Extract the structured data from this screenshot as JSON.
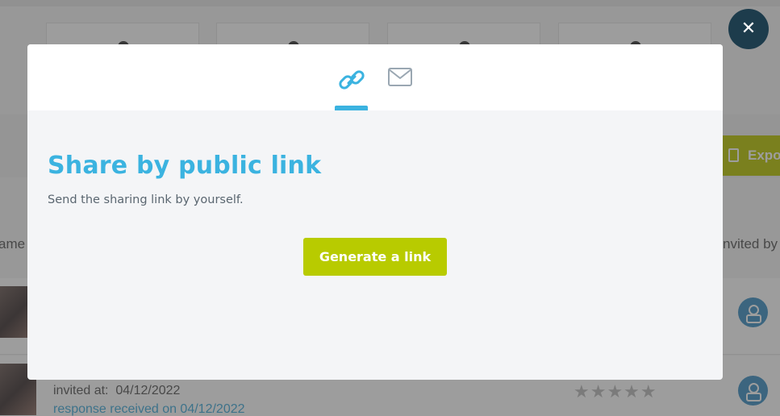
{
  "background": {
    "export_label": "Expo",
    "column_left_label": "ame",
    "column_right_label": "nvited by",
    "invited_label": "invited at:",
    "invited_date": "04/12/2022",
    "response_text": "response received on 04/12/2022",
    "stars": "★★★★★"
  },
  "close": {
    "glyph": "✕"
  },
  "modal": {
    "tabs": [
      {
        "name": "link",
        "icon": "link-icon",
        "active": true
      },
      {
        "name": "email",
        "icon": "envelope-icon",
        "active": false
      }
    ],
    "title": "Share by public link",
    "subtitle": "Send the sharing link by yourself.",
    "generate_button_label": "Generate a link"
  },
  "colors": {
    "accent_blue": "#3bb3e0",
    "button_green": "#b8cb00",
    "close_bg": "#1d3c4c"
  }
}
